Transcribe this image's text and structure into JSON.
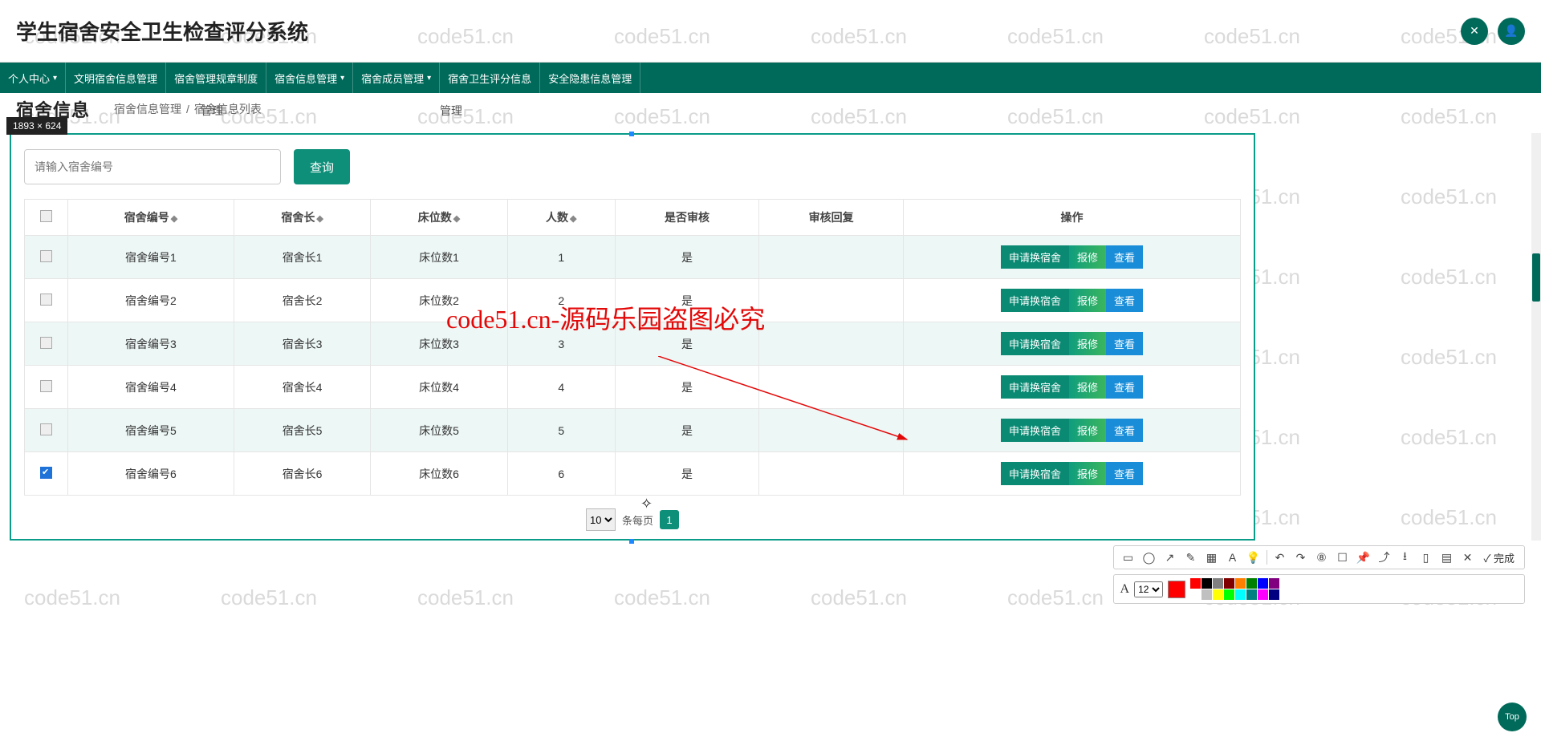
{
  "app_title": "学生宿舍安全卫生检查评分系统",
  "dimension_tag": "1893 × 624",
  "nav": [
    {
      "label": "个人中心",
      "caret": true
    },
    {
      "label": "文明宿舍信息管理",
      "caret": false
    },
    {
      "label": "宿舍管理规章制度",
      "caret": false
    },
    {
      "label": "宿舍信息管理",
      "caret": true
    },
    {
      "label": "宿舍成员管理",
      "caret": true
    },
    {
      "label": "宿舍卫生评分信息",
      "caret": false
    },
    {
      "label": "安全隐患信息管理",
      "caret": false
    }
  ],
  "crumb": {
    "title": "宿舍信息",
    "c1": "宿舍信息管理",
    "c2": "宿舍信息列表",
    "sep": "/"
  },
  "crumb_sub": [
    "管理",
    "管理"
  ],
  "search": {
    "placeholder": "请输入宿舍编号",
    "btn": "查询"
  },
  "table": {
    "headers": [
      "宿舍编号",
      "宿舍长",
      "床位数",
      "人数",
      "是否审核",
      "审核回复",
      "操作"
    ],
    "rows": [
      {
        "checked": false,
        "dorm": "宿舍编号1",
        "leader": "宿舍长1",
        "beds": "床位数1",
        "people": "1",
        "approved": "是",
        "reply": ""
      },
      {
        "checked": false,
        "dorm": "宿舍编号2",
        "leader": "宿舍长2",
        "beds": "床位数2",
        "people": "2",
        "approved": "是",
        "reply": ""
      },
      {
        "checked": false,
        "dorm": "宿舍编号3",
        "leader": "宿舍长3",
        "beds": "床位数3",
        "people": "3",
        "approved": "是",
        "reply": ""
      },
      {
        "checked": false,
        "dorm": "宿舍编号4",
        "leader": "宿舍长4",
        "beds": "床位数4",
        "people": "4",
        "approved": "是",
        "reply": ""
      },
      {
        "checked": false,
        "dorm": "宿舍编号5",
        "leader": "宿舍长5",
        "beds": "床位数5",
        "people": "5",
        "approved": "是",
        "reply": ""
      },
      {
        "checked": true,
        "dorm": "宿舍编号6",
        "leader": "宿舍长6",
        "beds": "床位数6",
        "people": "6",
        "approved": "是",
        "reply": ""
      }
    ],
    "actions": {
      "apply": "申请换宿舍",
      "repair": "报修",
      "view": "查看"
    }
  },
  "pager": {
    "per_page": "10",
    "label": "条每页",
    "page": "1"
  },
  "overlay_text": "code51.cn-源码乐园盗图必究",
  "toolbar": {
    "done": "✓ 完成",
    "font_size": "12",
    "letter": "A"
  },
  "swatch_main": "#ff0000",
  "swatches": [
    "#ff0000",
    "#000000",
    "#808080",
    "#800000",
    "#ff7f00",
    "#008000",
    "#0000ff",
    "#800080",
    "#ffffff",
    "#c0c0c0",
    "#ffff00",
    "#00ff00",
    "#00ffff",
    "#008080",
    "#ff00ff",
    "#000080"
  ],
  "watermark": "code51.cn",
  "top_btn": "Top"
}
